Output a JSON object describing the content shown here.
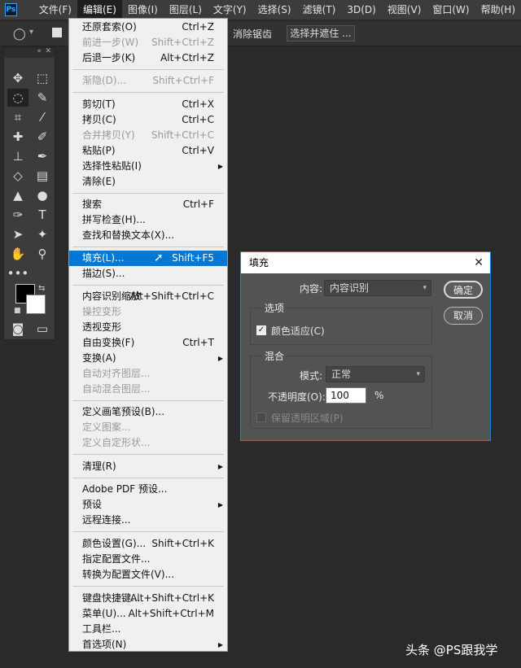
{
  "app": {
    "logo_text": "Ps"
  },
  "menubar": {
    "items": [
      "文件(F)",
      "编辑(E)",
      "图像(I)",
      "图层(L)",
      "文字(Y)",
      "选择(S)",
      "滤镜(T)",
      "3D(D)",
      "视图(V)",
      "窗口(W)",
      "帮助(H)"
    ],
    "active": "编辑(E)"
  },
  "options_bar": {
    "antialias": "消除锯齿",
    "select_mask": "选择并遮住 ..."
  },
  "edit_menu": {
    "items": [
      {
        "label": "还原套索(O)",
        "shortcut": "Ctrl+Z"
      },
      {
        "label": "前进一步(W)",
        "shortcut": "Shift+Ctrl+Z",
        "disabled": true
      },
      {
        "label": "后退一步(K)",
        "shortcut": "Alt+Ctrl+Z"
      },
      {
        "label": "渐隐(D)...",
        "shortcut": "Shift+Ctrl+F",
        "disabled": true
      },
      {
        "label": "剪切(T)",
        "shortcut": "Ctrl+X"
      },
      {
        "label": "拷贝(C)",
        "shortcut": "Ctrl+C"
      },
      {
        "label": "合并拷贝(Y)",
        "shortcut": "Shift+Ctrl+C",
        "disabled": true
      },
      {
        "label": "粘贴(P)",
        "shortcut": "Ctrl+V"
      },
      {
        "label": "选择性粘贴(I)",
        "submenu": true
      },
      {
        "label": "清除(E)"
      },
      {
        "label": "搜索",
        "shortcut": "Ctrl+F"
      },
      {
        "label": "拼写检查(H)..."
      },
      {
        "label": "查找和替换文本(X)..."
      },
      {
        "label": "填充(L)...",
        "shortcut": "Shift+F5",
        "highlighted": true
      },
      {
        "label": "描边(S)..."
      },
      {
        "label": "内容识别缩放",
        "shortcut": "Alt+Shift+Ctrl+C"
      },
      {
        "label": "操控变形",
        "disabled": true
      },
      {
        "label": "透视变形"
      },
      {
        "label": "自由变换(F)",
        "shortcut": "Ctrl+T"
      },
      {
        "label": "变换(A)",
        "submenu": true
      },
      {
        "label": "自动对齐图层...",
        "disabled": true
      },
      {
        "label": "自动混合图层...",
        "disabled": true
      },
      {
        "label": "定义画笔预设(B)..."
      },
      {
        "label": "定义图案...",
        "disabled": true
      },
      {
        "label": "定义自定形状...",
        "disabled": true
      },
      {
        "label": "清理(R)",
        "submenu": true
      },
      {
        "label": "Adobe PDF 预设..."
      },
      {
        "label": "预设",
        "submenu": true
      },
      {
        "label": "远程连接..."
      },
      {
        "label": "颜色设置(G)...",
        "shortcut": "Shift+Ctrl+K"
      },
      {
        "label": "指定配置文件..."
      },
      {
        "label": "转换为配置文件(V)..."
      },
      {
        "label": "键盘快捷键...",
        "shortcut": "Alt+Shift+Ctrl+K"
      },
      {
        "label": "菜单(U)...",
        "shortcut": "Alt+Shift+Ctrl+M"
      },
      {
        "label": "工具栏..."
      },
      {
        "label": "首选项(N)",
        "submenu": true
      }
    ]
  },
  "fill_dialog": {
    "title": "填充",
    "content_label": "内容:",
    "content_value": "内容识别",
    "ok_label": "确定",
    "cancel_label": "取消",
    "options_title": "选项",
    "color_adapt_label": "颜色适应(C)",
    "blend_title": "混合",
    "mode_label": "模式:",
    "mode_value": "正常",
    "opacity_label": "不透明度(O):",
    "opacity_value": "100",
    "opacity_unit": "%",
    "preserve_label": "保留透明区域(P)"
  },
  "watermark": "头条 @PS跟我学"
}
